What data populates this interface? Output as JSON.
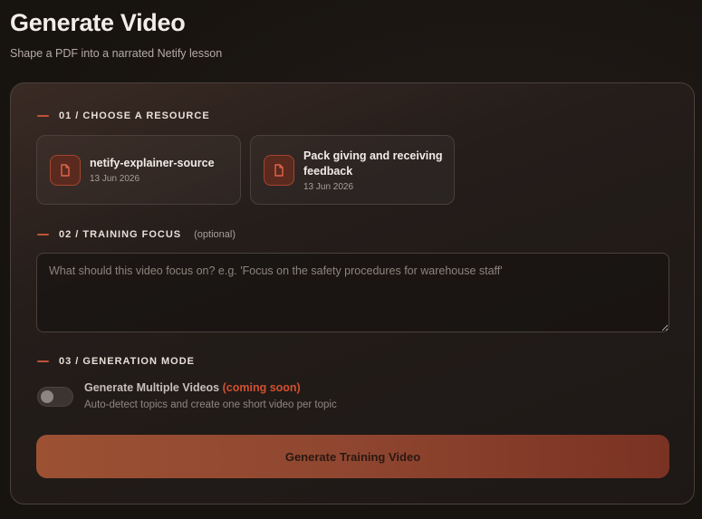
{
  "header": {
    "title": "Generate Video",
    "subtitle": "Shape a PDF into a narrated Netify lesson"
  },
  "sections": {
    "resource": {
      "title": "01 / CHOOSE A RESOURCE"
    },
    "focus": {
      "title": "02 / TRAINING FOCUS",
      "optional": "(optional)",
      "placeholder": "What should this video focus on? e.g. 'Focus on the safety procedures for warehouse staff'"
    },
    "mode": {
      "title": "03 / GENERATION MODE"
    }
  },
  "resources": [
    {
      "name": "netify-explainer-source",
      "date": "13 Jun 2026",
      "icon": "file-icon"
    },
    {
      "name": "Pack giving and receiving feedback",
      "date": "13 Jun 2026",
      "icon": "file-icon"
    }
  ],
  "mode": {
    "label": "Generate Multiple Videos",
    "badge": "(coming soon)",
    "description": "Auto-detect topics and create one short video per topic",
    "enabled": false
  },
  "actions": {
    "generate_label": "Generate Training Video"
  },
  "colors": {
    "accent": "#c2523a",
    "coming_soon": "#d3502f",
    "button_start": "#9c5133",
    "button_end": "#7a3222"
  }
}
